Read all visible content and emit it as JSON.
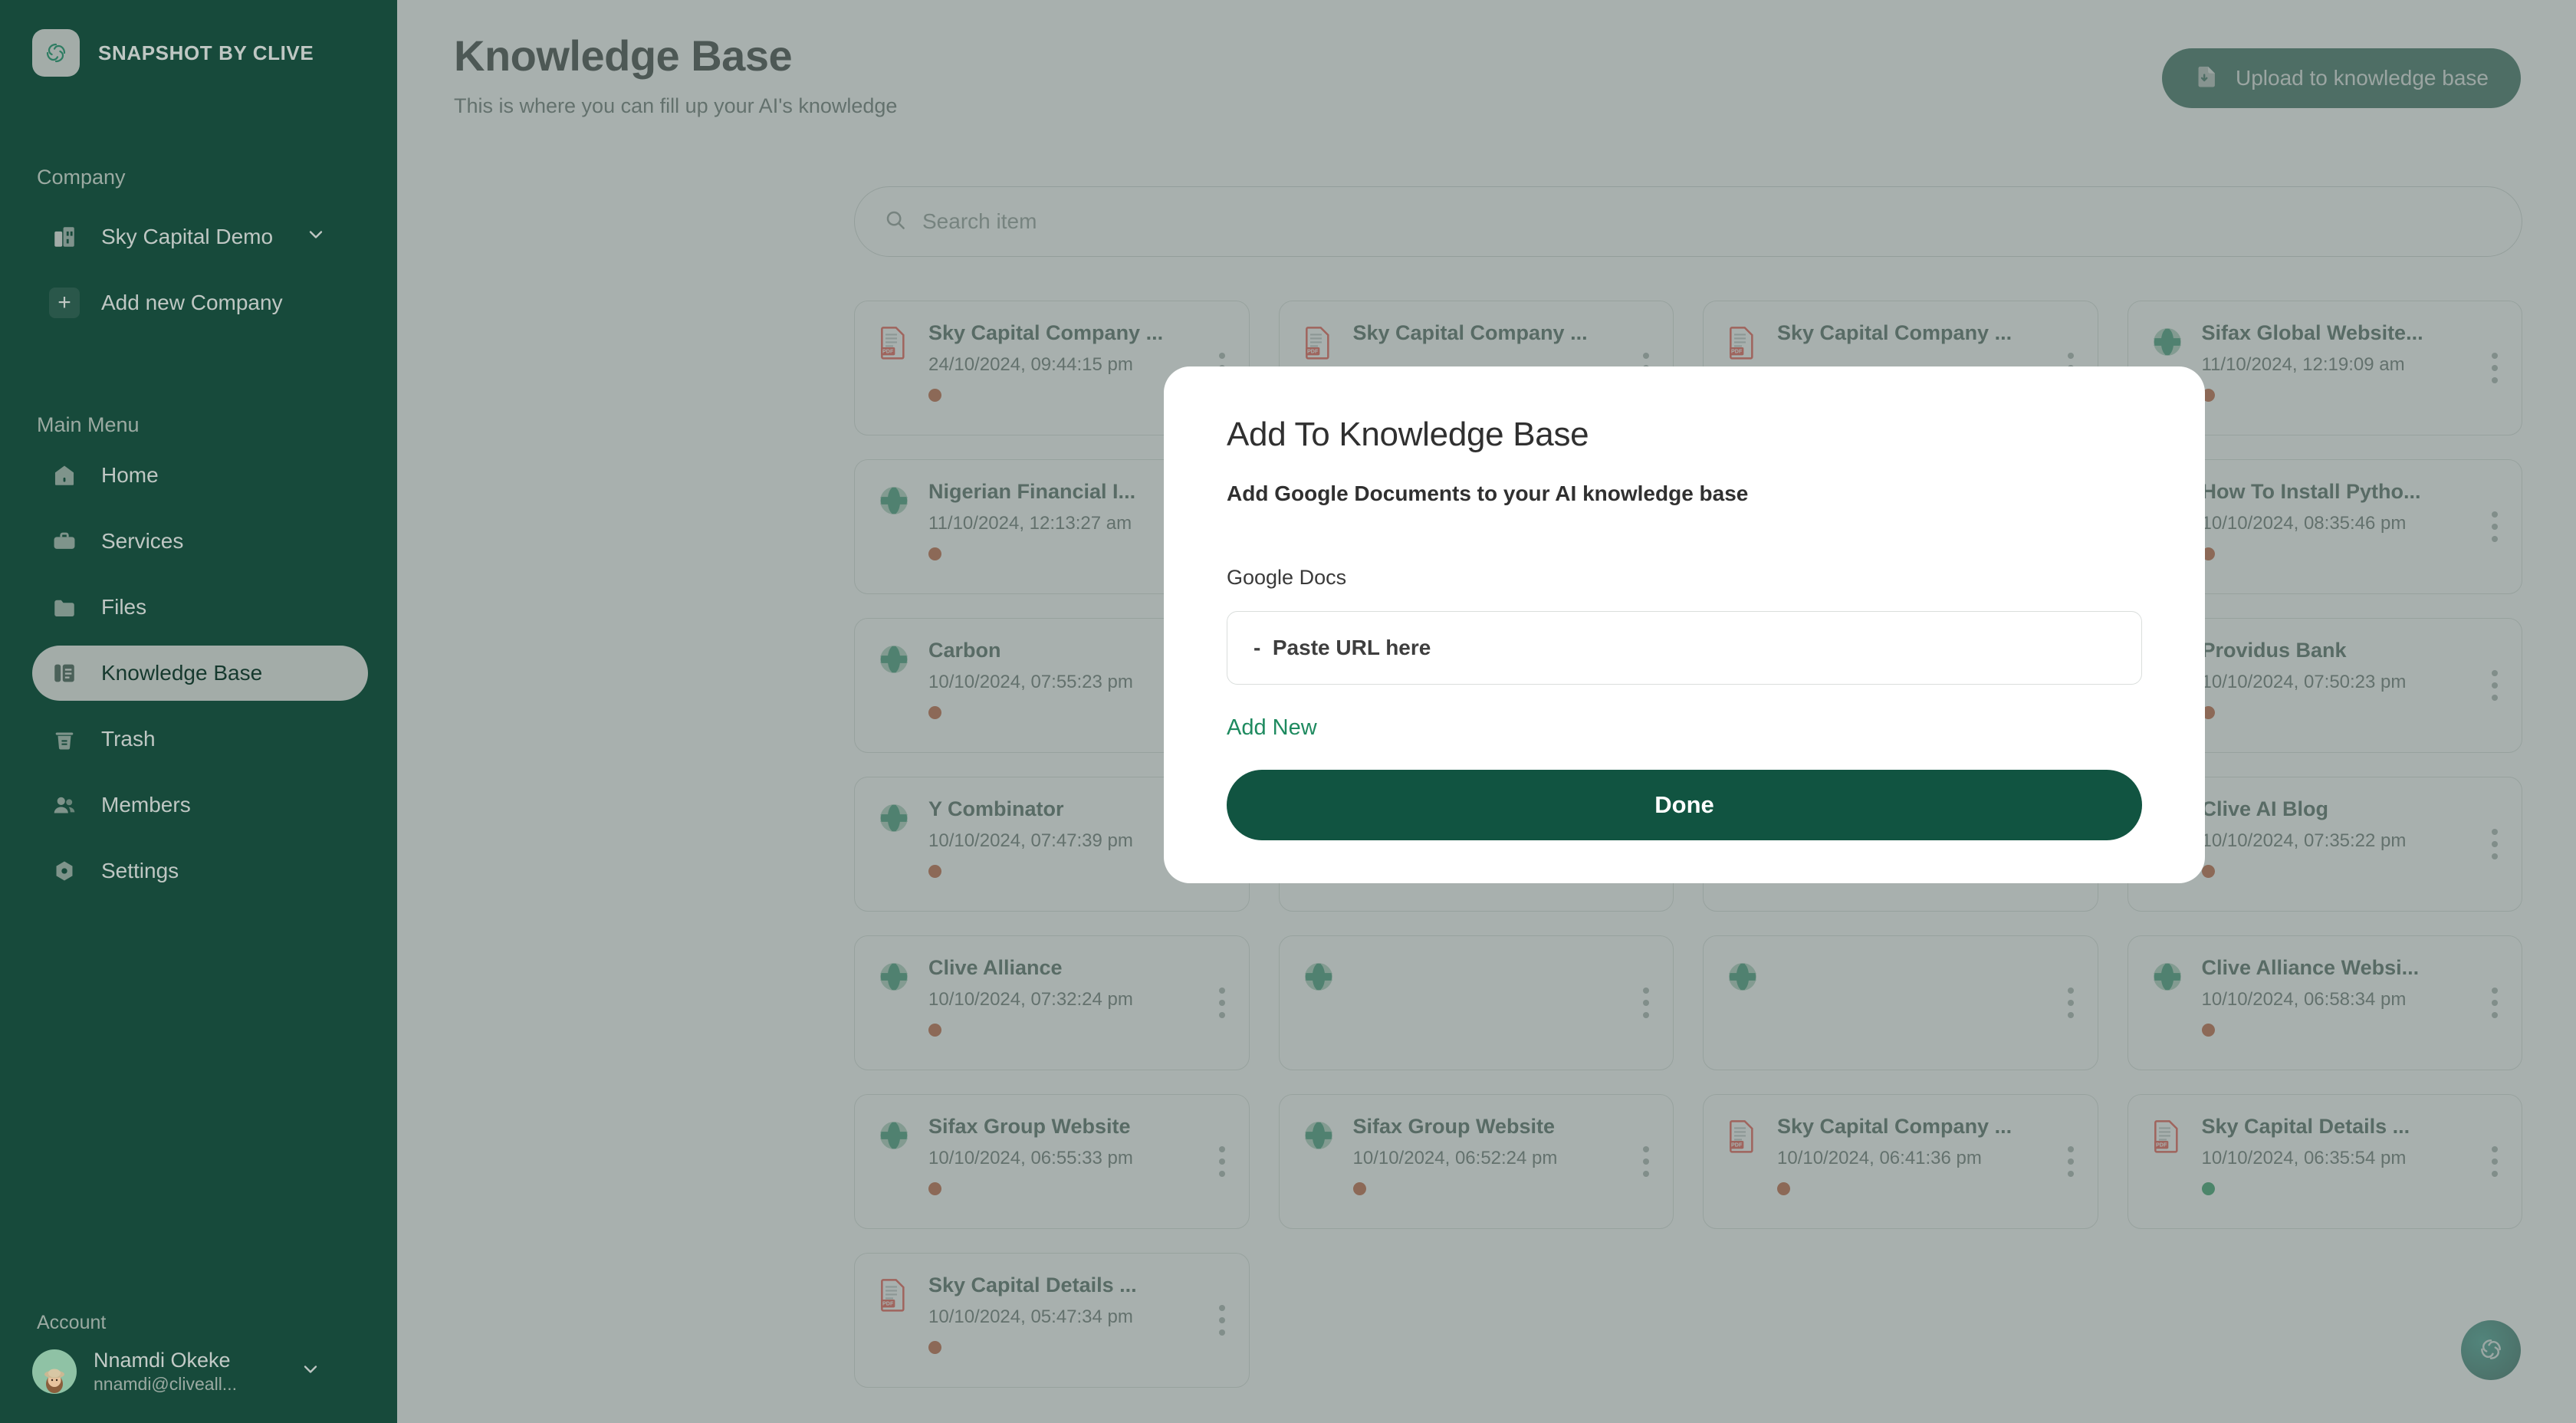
{
  "sidebar": {
    "brand": {
      "name": "SNAPSHOT BY CLIVE",
      "icon": "clive-logo-icon"
    },
    "company_section_label": "Company",
    "company_selected": "Sky Capital Demo",
    "add_company_label": "Add new Company",
    "main_menu_label": "Main Menu",
    "menu": [
      {
        "label": "Home",
        "icon": "home-icon",
        "active": false
      },
      {
        "label": "Services",
        "icon": "services-icon",
        "active": false
      },
      {
        "label": "Files",
        "icon": "folder-icon",
        "active": false
      },
      {
        "label": "Knowledge Base",
        "icon": "knowledge-base-icon",
        "active": true
      },
      {
        "label": "Trash",
        "icon": "trash-icon",
        "active": false
      },
      {
        "label": "Members",
        "icon": "members-icon",
        "active": false
      },
      {
        "label": "Settings",
        "icon": "settings-icon",
        "active": false
      }
    ],
    "account_label": "Account",
    "account_name": "Nnamdi Okeke",
    "account_email": "nnamdi@cliveall..."
  },
  "header": {
    "title": "Knowledge Base",
    "subtitle": "This is where you can fill up your AI's knowledge",
    "upload_label": "Upload to knowledge base"
  },
  "search": {
    "placeholder": "Search item",
    "value": ""
  },
  "cards": [
    {
      "title": "Sky Capital Company ...",
      "date": "24/10/2024, 09:44:15 pm",
      "type": "pdf",
      "status": "orange"
    },
    {
      "title": "Sky Capital Company ...",
      "date": "",
      "type": "pdf",
      "status": "hidden"
    },
    {
      "title": "Sky Capital Company ...",
      "date": "",
      "type": "pdf",
      "status": "hidden"
    },
    {
      "title": "Sifax Global Website...",
      "date": "11/10/2024, 12:19:09 am",
      "type": "web",
      "status": "orange"
    },
    {
      "title": "Nigerian Financial I...",
      "date": "11/10/2024, 12:13:27 am",
      "type": "web",
      "status": "orange"
    },
    {
      "title": "",
      "date": "",
      "type": "web",
      "status": "hidden"
    },
    {
      "title": "",
      "date": "",
      "type": "web",
      "status": "hidden"
    },
    {
      "title": "How To Install Pytho...",
      "date": "10/10/2024, 08:35:46 pm",
      "type": "web",
      "status": "orange"
    },
    {
      "title": "Carbon",
      "date": "10/10/2024, 07:55:23 pm",
      "type": "web",
      "status": "orange"
    },
    {
      "title": "",
      "date": "",
      "type": "web",
      "status": "hidden"
    },
    {
      "title": "",
      "date": "",
      "type": "web",
      "status": "hidden"
    },
    {
      "title": "Providus Bank",
      "date": "10/10/2024, 07:50:23 pm",
      "type": "web",
      "status": "orange"
    },
    {
      "title": "Y Combinator",
      "date": "10/10/2024, 07:47:39 pm",
      "type": "web",
      "status": "orange"
    },
    {
      "title": "",
      "date": "",
      "type": "web",
      "status": "hidden"
    },
    {
      "title": "",
      "date": "",
      "type": "web",
      "status": "hidden"
    },
    {
      "title": "Clive AI Blog",
      "date": "10/10/2024, 07:35:22 pm",
      "type": "web",
      "status": "orange"
    },
    {
      "title": "Clive Alliance",
      "date": "10/10/2024, 07:32:24 pm",
      "type": "web",
      "status": "orange"
    },
    {
      "title": "",
      "date": "",
      "type": "web",
      "status": "hidden"
    },
    {
      "title": "",
      "date": "",
      "type": "web",
      "status": "hidden"
    },
    {
      "title": "Clive Alliance Websi...",
      "date": "10/10/2024, 06:58:34 pm",
      "type": "web",
      "status": "orange"
    },
    {
      "title": "Sifax Group Website",
      "date": "10/10/2024, 06:55:33 pm",
      "type": "web",
      "status": "orange"
    },
    {
      "title": "Sifax Group Website",
      "date": "10/10/2024, 06:52:24 pm",
      "type": "web",
      "status": "orange"
    },
    {
      "title": "Sky Capital Company ...",
      "date": "10/10/2024, 06:41:36 pm",
      "type": "pdf",
      "status": "orange"
    },
    {
      "title": "Sky Capital Details ...",
      "date": "10/10/2024, 06:35:54 pm",
      "type": "pdf",
      "status": "green"
    },
    {
      "title": "Sky Capital Details ...",
      "date": "10/10/2024, 05:47:34 pm",
      "type": "pdf",
      "status": "orange"
    }
  ],
  "modal": {
    "title": "Add To Knowledge Base",
    "subtitle": "Add Google Documents to your AI knowledge base",
    "field_label": "Google Docs",
    "url_placeholder": "-  Paste URL here",
    "url_value": "",
    "add_new_label": "Add New",
    "done_label": "Done"
  },
  "fab": {
    "icon": "clive-assistant-icon"
  },
  "colors": {
    "sidebar_bg": "#174A3B",
    "brand_green": "#115441",
    "accent_green": "#1E8A5F",
    "status_orange": "#B5451B",
    "status_green": "#0E8F4E",
    "overlay": "rgba(115,128,124,0.62)"
  }
}
